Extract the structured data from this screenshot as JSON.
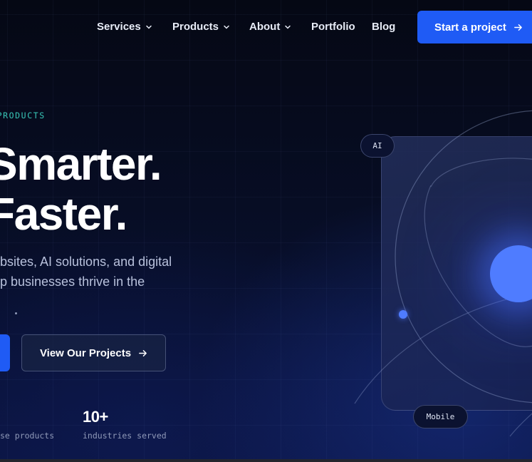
{
  "nav": {
    "items": [
      {
        "label": "Services",
        "has_dropdown": true
      },
      {
        "label": "Products",
        "has_dropdown": true
      },
      {
        "label": "About",
        "has_dropdown": true
      },
      {
        "label": "Portfolio",
        "has_dropdown": false
      },
      {
        "label": "Blog",
        "has_dropdown": false
      }
    ],
    "cta_label": "Start a project",
    "cta_icon": "arrow-right-icon"
  },
  "hero": {
    "eyebrow": "AL PRODUCTS",
    "headline_line1": "Smarter.",
    "headline_line2": "Faster.",
    "description_line1": "bsites, AI solutions, and digital",
    "description_line2": "p businesses thrive in the",
    "secondary_button_label": "View Our Projects",
    "secondary_button_icon": "arrow-right-icon"
  },
  "stats": [
    {
      "value": "",
      "label": "se products"
    },
    {
      "value": "10+",
      "label": "industries served"
    }
  ],
  "visual": {
    "chip_top": "AI",
    "chip_bottom": "Mobile"
  },
  "colors": {
    "accent": "#1f5bf5",
    "eyebrow": "#38c7b8",
    "core": "#4f7cff",
    "background": "#050a1c"
  }
}
